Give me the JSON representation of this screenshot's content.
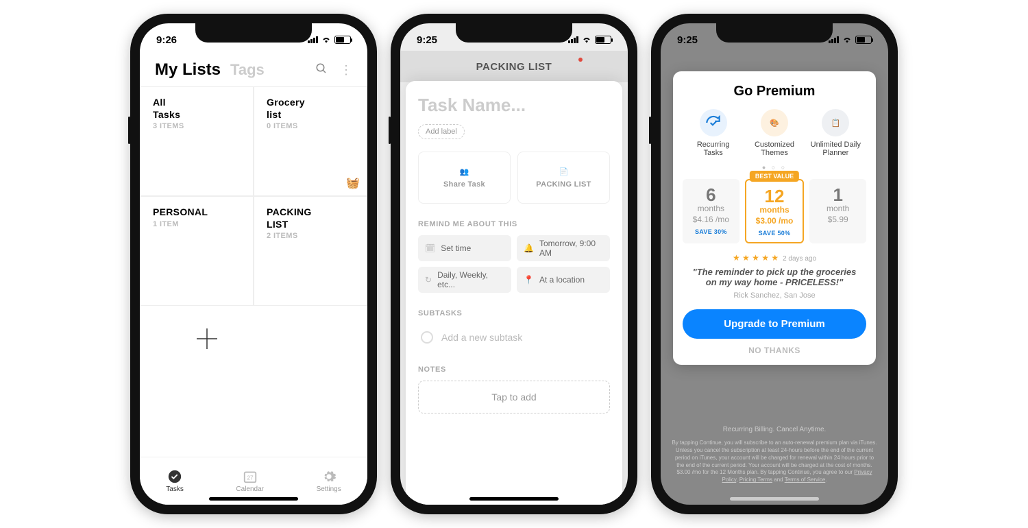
{
  "phone1": {
    "status_time": "9:26",
    "header": {
      "title": "My Lists",
      "tags_label": "Tags"
    },
    "lists": [
      {
        "name": "All\nTasks",
        "count": "3 ITEMS"
      },
      {
        "name": "Grocery\nlist",
        "count": "0 ITEMS"
      },
      {
        "name": "PERSONAL",
        "count": "1 ITEM"
      },
      {
        "name": "PACKING\nLIST",
        "count": "2 ITEMS"
      }
    ],
    "tabs": [
      {
        "label": "Tasks",
        "active": true
      },
      {
        "label": "Calendar",
        "active": false,
        "day": "27"
      },
      {
        "label": "Settings",
        "active": false
      }
    ]
  },
  "phone2": {
    "status_time": "9:25",
    "bg_title": "PACKING LIST",
    "task_placeholder": "Task Name...",
    "add_label_chip": "Add label",
    "share_label": "Share Task",
    "list_label": "PACKING LIST",
    "remind_header": "REMIND ME ABOUT THIS",
    "reminders": {
      "set_time": "Set time",
      "tomorrow": "Tomorrow, 9:00 AM",
      "repeat": "Daily, Weekly, etc...",
      "location": "At a location"
    },
    "subtasks_header": "SUBTASKS",
    "subtask_placeholder": "Add a new subtask",
    "notes_header": "NOTES",
    "notes_placeholder": "Tap to add"
  },
  "phone3": {
    "status_time": "9:25",
    "title": "Go Premium",
    "features": [
      {
        "label": "Recurring\nTasks"
      },
      {
        "label": "Customized\nThemes"
      },
      {
        "label": "Unlimited Daily\nPlanner"
      }
    ],
    "best_value_badge": "BEST VALUE",
    "plans": [
      {
        "num": "6",
        "unit": "months",
        "price": "$4.16 /mo",
        "save": "SAVE 30%"
      },
      {
        "num": "12",
        "unit": "months",
        "price": "$3.00 /mo",
        "save": "SAVE 50%",
        "best": true
      },
      {
        "num": "1",
        "unit": "month",
        "price": "$5.99",
        "save": ""
      }
    ],
    "review_time": "2 days ago",
    "quote": "\"The reminder to pick up the groceries on my way home - PRICELESS!\"",
    "author": "Rick Sanchez, San Jose",
    "cta": "Upgrade to Premium",
    "no_thanks": "NO THANKS",
    "footer_heading": "Recurring Billing. Cancel Anytime.",
    "footer_body": "By tapping Continue, you will subscribe to an auto-renewal premium plan via iTunes. Unless you cancel the subscription at least 24-hours before the end of the current period on iTunes, your account will be charged for renewal within 24 hours prior to the end of the current period. Your account will be charged at the cost of months.",
    "footer_price_line": "$3.00 /mo for the 12 Months plan. By tapping Continue, you agree to our ",
    "footer_links": {
      "privacy": "Privacy Policy",
      "pricing": "Pricing Terms",
      "and": " and ",
      "tos": "Terms of Service"
    }
  }
}
